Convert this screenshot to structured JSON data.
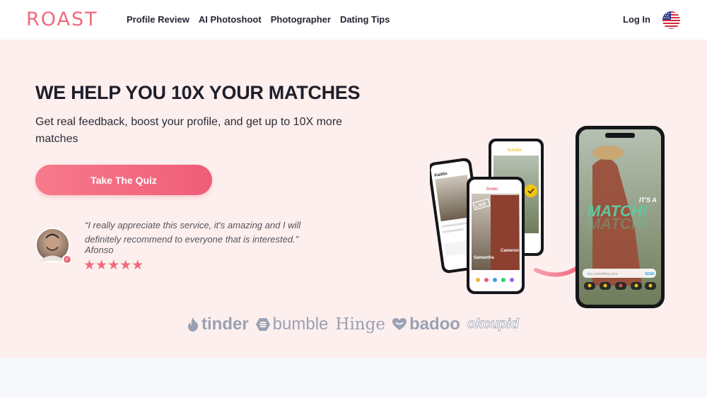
{
  "header": {
    "logo": "ROAST",
    "nav": [
      "Profile Review",
      "AI Photoshoot",
      "Photographer",
      "Dating Tips"
    ],
    "login": "Log In",
    "flag_icon": "us-flag-icon"
  },
  "hero": {
    "headline": "WE HELP YOU 10X YOUR MATCHES",
    "subline": "Get real feedback, boost your profile, and get up to 10X more matches",
    "cta": "Take The Quiz",
    "testimonial": {
      "quote": "“I really appreciate this service, it's amazing and I will definitely recommend to everyone that is interested.”",
      "author": "Afonso",
      "rating": 5,
      "stars": "★★★★★"
    }
  },
  "illustration": {
    "phone1_name": "Kaitlin",
    "phone2_header": "bumble",
    "phone3_header": "tinder",
    "phone3_names": [
      "Samantha",
      "Cameron"
    ],
    "like_stamp": "LIKE",
    "match_top": "IT'S A",
    "match_text": "MATCH!",
    "message_placeholder": "Say something nice",
    "send_label": "SEND"
  },
  "brands": [
    "tinder",
    "bumble",
    "Hinge",
    "badoo",
    "okcupid"
  ],
  "colors": {
    "accent": "#f06a7c",
    "hero_bg": "#fdefed",
    "brand_gray": "#9aa1b4",
    "match_green": "#5cc9a0"
  }
}
